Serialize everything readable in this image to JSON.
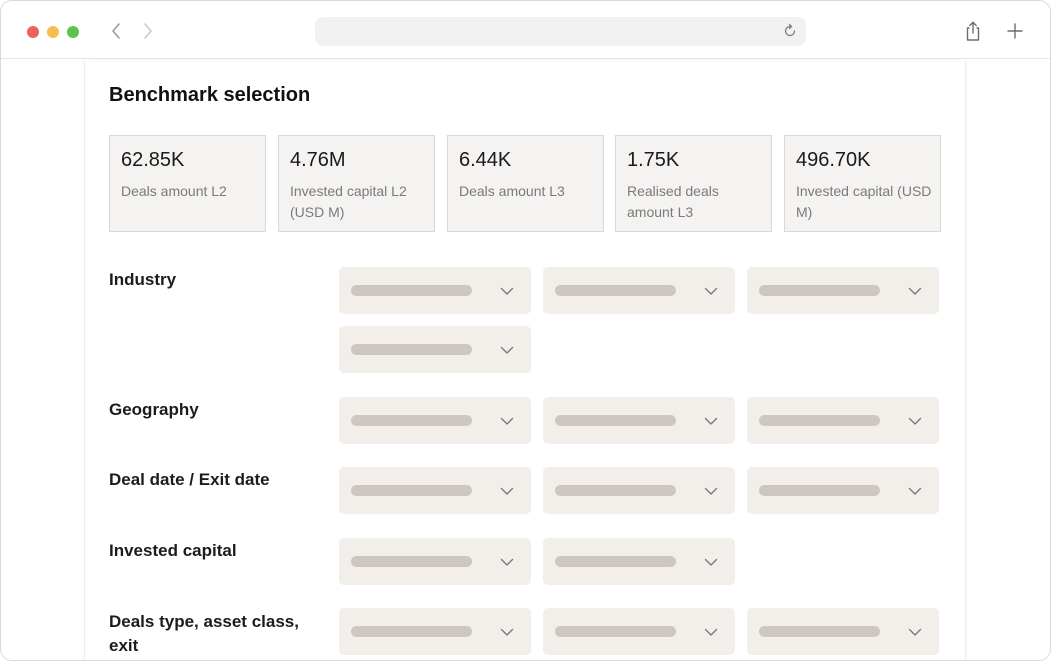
{
  "page": {
    "title": "Benchmark selection"
  },
  "stats": [
    {
      "value": "62.85K",
      "label": "Deals amount L2"
    },
    {
      "value": "4.76M",
      "label": "Invested capital L2 (USD M)"
    },
    {
      "value": "6.44K",
      "label": "Deals amount L3"
    },
    {
      "value": "1.75K",
      "label": "Realised deals amount L3"
    },
    {
      "value": "496.70K",
      "label": "Invested capital (USD M)"
    }
  ],
  "filters": [
    {
      "label": "Industry"
    },
    {
      "label": "Geography"
    },
    {
      "label": "Deal date / Exit date"
    },
    {
      "label": "Invested capital"
    },
    {
      "label": "Deals type, asset class, exit"
    }
  ],
  "icons": {
    "back": "chevron-left-icon",
    "forward": "chevron-right-icon",
    "reload": "reload-icon",
    "share": "share-icon",
    "new_tab": "plus-icon",
    "dropdown": "chevron-down-icon"
  },
  "colors": {
    "stat_bg": "#f5f3f1",
    "dropdown_bg": "#f2efeb",
    "placeholder_bar": "#cdc7c0"
  }
}
